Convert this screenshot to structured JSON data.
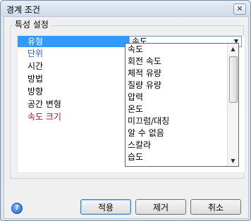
{
  "window": {
    "title": "경계 조건",
    "close_label": "✕"
  },
  "group": {
    "label": "특성 설정"
  },
  "properties": [
    {
      "label": "유형",
      "style": "selected"
    },
    {
      "label": "단위",
      "style": "blue"
    },
    {
      "label": "시간",
      "style": "normal"
    },
    {
      "label": "방법",
      "style": "normal"
    },
    {
      "label": "방향",
      "style": "normal"
    },
    {
      "label": "공간 변형",
      "style": "normal"
    },
    {
      "label": "속도 크기",
      "style": "red"
    }
  ],
  "type_select": {
    "value": "속도",
    "arrow_icon": "chevron-down-icon"
  },
  "dropdown_options": [
    "속도",
    "회전 속도",
    "체적 유량",
    "질량 유량",
    "압력",
    "온도",
    "미끄럼/대칭",
    "알 수 없음",
    "스칼라",
    "습도"
  ],
  "buttons": {
    "apply": "적용",
    "remove": "제거",
    "cancel": "취소"
  },
  "help_icon": "?"
}
